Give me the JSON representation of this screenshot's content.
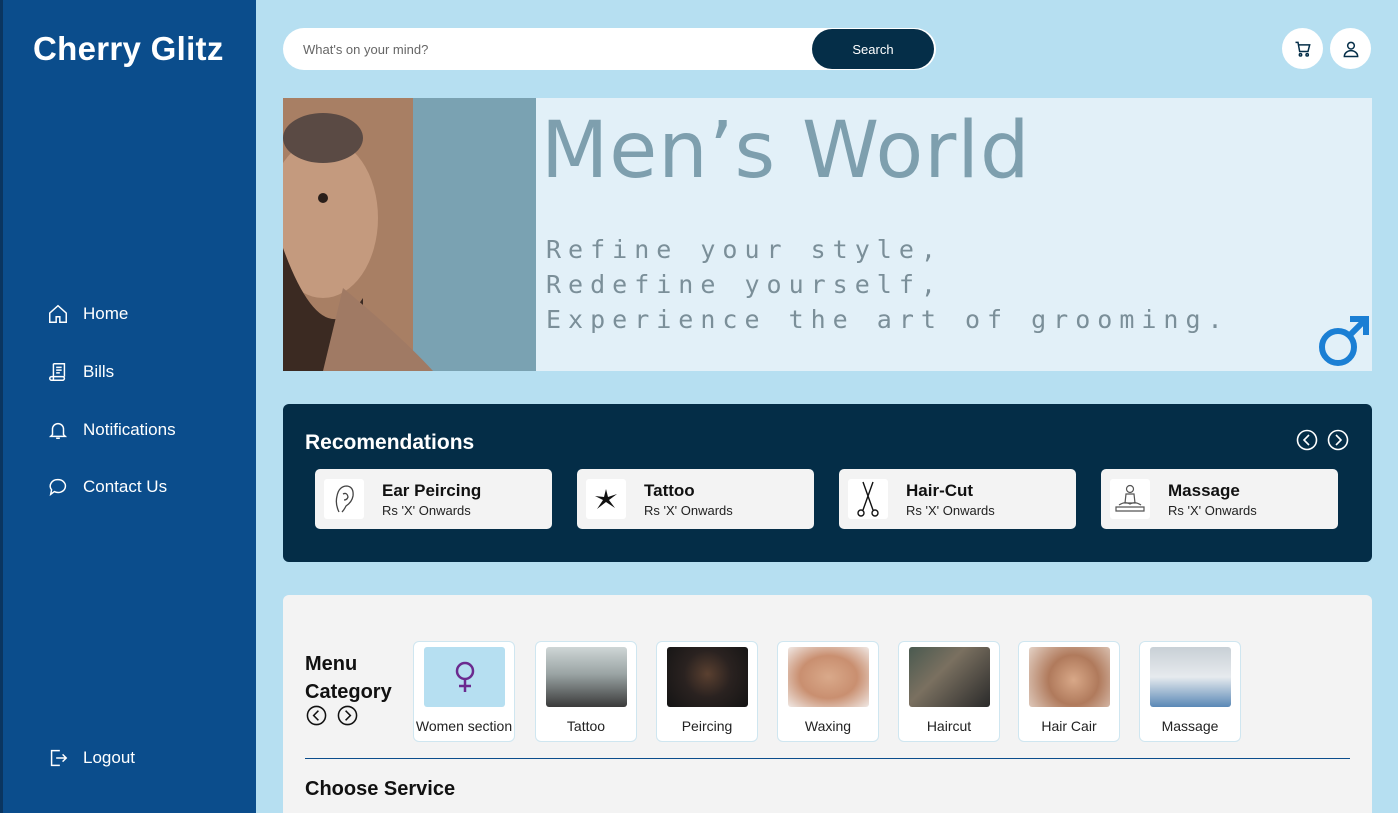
{
  "brand": "Cherry Glitz",
  "nav": [
    {
      "label": "Home",
      "icon": "home-icon"
    },
    {
      "label": "Bills",
      "icon": "bill-icon"
    },
    {
      "label": "Notifications",
      "icon": "bell-icon"
    },
    {
      "label": "Contact Us",
      "icon": "chat-icon"
    }
  ],
  "logout": {
    "label": "Logout",
    "icon": "logout-icon"
  },
  "search": {
    "placeholder": "What's on your mind?",
    "button": "Search"
  },
  "banner": {
    "title": "Men’s World",
    "taglines": [
      "Refine your style,",
      "Redefine yourself,",
      "Experience the art of grooming."
    ]
  },
  "recommendations": {
    "title": "Recomendations",
    "items": [
      {
        "name": "Ear Peircing",
        "price": "Rs 'X' Onwards",
        "icon": "ear-icon"
      },
      {
        "name": "Tattoo",
        "price": "Rs 'X' Onwards",
        "icon": "tattoo-icon"
      },
      {
        "name": "Hair-Cut",
        "price": "Rs 'X' Onwards",
        "icon": "scissors-icon"
      },
      {
        "name": "Massage",
        "price": "Rs 'X' Onwards",
        "icon": "massage-icon"
      }
    ]
  },
  "menu": {
    "title_line1": "Menu",
    "title_line2": "Category",
    "categories": [
      {
        "label": "Women section"
      },
      {
        "label": "Tattoo"
      },
      {
        "label": "Peircing"
      },
      {
        "label": "Waxing"
      },
      {
        "label": "Haircut"
      },
      {
        "label": "Hair Cair"
      },
      {
        "label": "Massage"
      }
    ]
  },
  "choose_service": "Choose Service",
  "colors": {
    "sidebar": "#0b4d8c",
    "dark_panel": "#042d47",
    "background": "#b6dff1",
    "accent_male": "#1b7fd4"
  }
}
